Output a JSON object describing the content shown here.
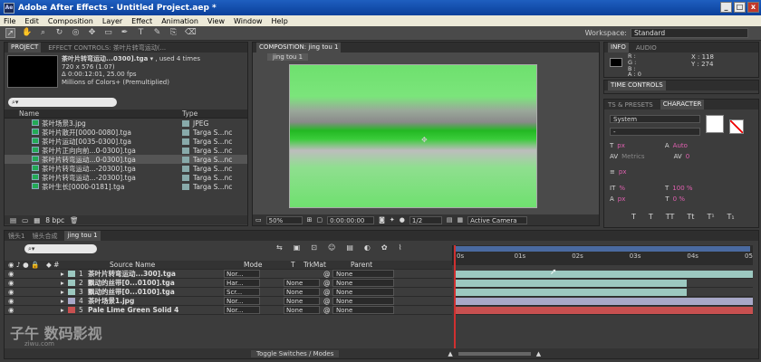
{
  "window": {
    "title": "Adobe After Effects - Untitled Project.aep *",
    "app_icon": "Ae",
    "controls": [
      "_",
      "□",
      "x"
    ]
  },
  "menu": [
    "File",
    "Edit",
    "Composition",
    "Layer",
    "Effect",
    "Animation",
    "View",
    "Window",
    "Help"
  ],
  "toolbar": {
    "workspace_label": "Workspace:",
    "workspace_value": "Standard"
  },
  "project_panel": {
    "tabs": [
      "PROJECT",
      "EFFECT CONTROLS: 茶叶片转弯运动(..."
    ],
    "selected_name": "茶叶片转弯运动...0300].tga",
    "used_times": "▾ , used 4 times",
    "info_lines": [
      "720 x 576 (1.07)",
      "Δ 0:00:12:01, 25.00 fps",
      "Millions of Colors+ (Premultiplied)"
    ],
    "search_placeholder": "",
    "columns": [
      "Name",
      "Type"
    ],
    "items": [
      {
        "name": "茶叶场景3.jpg",
        "type": "JPEG"
      },
      {
        "name": "茶叶片散开[0000-0080].tga",
        "type": "Targa S...nc"
      },
      {
        "name": "茶叶片运动[0035-0300].tga",
        "type": "Targa S...nc"
      },
      {
        "name": "茶叶片正向向前...0-0300].tga",
        "type": "Targa S...nc"
      },
      {
        "name": "茶叶片转弯运动...0-0300].tga",
        "type": "Targa S...nc"
      },
      {
        "name": "茶叶片转弯运动...-20300].tga",
        "type": "Targa S...nc"
      },
      {
        "name": "茶叶片转弯运动...-20300].tga",
        "type": "Targa S...nc"
      },
      {
        "name": "茶叶生长[0000-0181].tga",
        "type": "Targa S...nc"
      }
    ],
    "bpc": "8 bpc"
  },
  "comp_panel": {
    "tab": "COMPOSITION: jing tou 1",
    "subtab": "jing tou 1",
    "zoom": "50%",
    "timecode": "0:00:00:00",
    "resolution": "1/2",
    "camera": "Active Camera"
  },
  "info_panel": {
    "tabs": [
      "INFO",
      "AUDIO"
    ],
    "channels": [
      "R :",
      "G :",
      "B :",
      "A : 0"
    ],
    "x": "X : 118",
    "y": "Y : 274"
  },
  "time_controls": {
    "tab": "TIME CONTROLS"
  },
  "character_panel": {
    "tabs": [
      "TS & PRESETS",
      "CHARACTER"
    ],
    "font": "System",
    "style": "-",
    "size": "px",
    "leading": "Auto",
    "metrics": "Metrics",
    "tracking": "0",
    "stroke": "px",
    "vscale": "%",
    "hscale": "100 %",
    "baseline": "px",
    "tsume": "0 %"
  },
  "timeline": {
    "tabs": [
      "镜头1",
      "镜头合成",
      "jing tou 1"
    ],
    "search_placeholder": "",
    "columns": {
      "source": "Source Name",
      "mode": "Mode",
      "t": "T",
      "trkmat": "TrkMat",
      "parent": "Parent"
    },
    "ruler": [
      "0s",
      "01s",
      "02s",
      "03s",
      "04s",
      "05"
    ],
    "layers": [
      {
        "num": "1",
        "name": "茶叶片转弯运动...300].tga",
        "mode": "Nor...",
        "trkmat": "",
        "parent": "None",
        "color": "#9cc8c0"
      },
      {
        "num": "2",
        "name": "飘动的丝带[0...0100].tga",
        "mode": "Har...",
        "trkmat": "None",
        "parent": "None",
        "color": "#9cc8c0"
      },
      {
        "num": "3",
        "name": "飘动的丝带[0...0100].tga",
        "mode": "Scr...",
        "trkmat": "None",
        "parent": "None",
        "color": "#9cc8c0"
      },
      {
        "num": "4",
        "name": "茶叶场景1.jpg",
        "mode": "Nor...",
        "trkmat": "None",
        "parent": "None",
        "color": "#a8a8c8"
      },
      {
        "num": "5",
        "name": "Pale Lime Green Solid 4",
        "mode": "Nor...",
        "trkmat": "None",
        "parent": "None",
        "color": "#c85050"
      }
    ],
    "toggle_label": "Toggle Switches / Modes"
  },
  "watermark": {
    "text": "子午 数码影视",
    "url": "ziwu.com"
  }
}
